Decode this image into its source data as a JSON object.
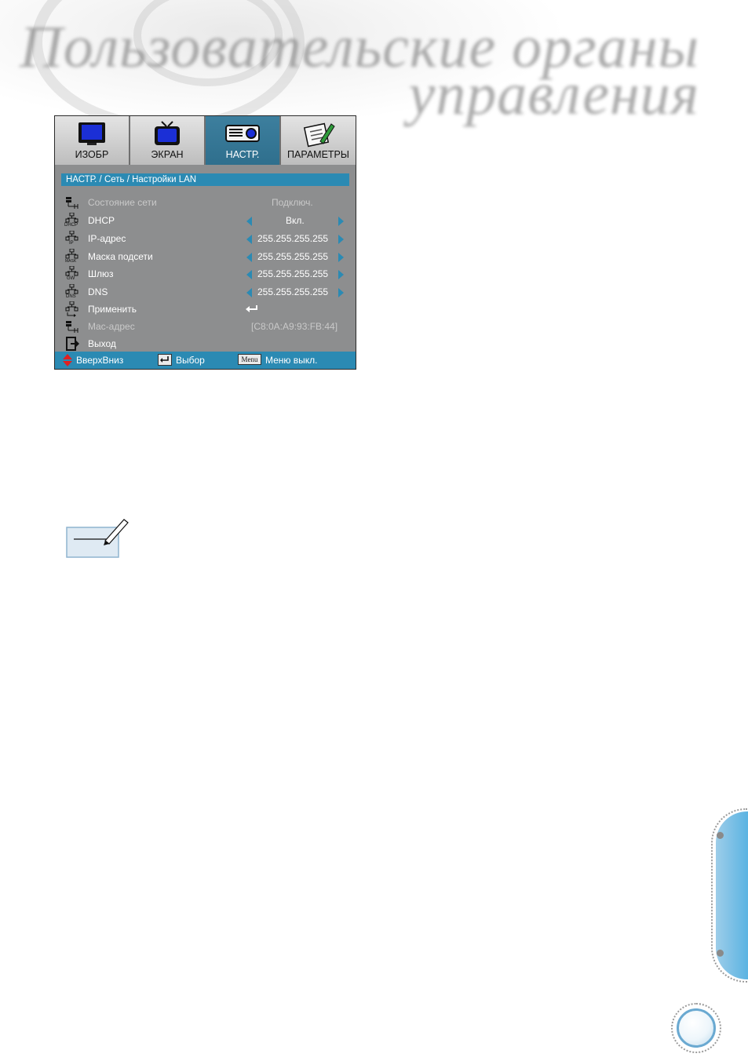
{
  "header": {
    "title_line1": "Пользовательские органы",
    "title_line2": "управления"
  },
  "osd": {
    "tabs": [
      {
        "label": "ИЗОБР",
        "icon": "monitor-icon",
        "active": false
      },
      {
        "label": "ЭКРАН",
        "icon": "tv-icon",
        "active": false
      },
      {
        "label": "НАСТР.",
        "icon": "projector-icon",
        "active": true
      },
      {
        "label": "ПАРАМЕТРЫ",
        "icon": "notepad-pen-icon",
        "active": false
      }
    ],
    "breadcrumb": "НАСТР. / Сеть / Настройки LAN",
    "rows": [
      {
        "label": "Состояние сети",
        "value": "Подключ.",
        "icon": "network-status-icon",
        "icon_text": ""
      },
      {
        "label": "DHCP",
        "value": "Вкл.",
        "icon": "network-dhcp-icon",
        "icon_text": "DHCP"
      },
      {
        "label": "IP-адрес",
        "value": "255.255.255.255",
        "icon": "network-ip-icon",
        "icon_text": "IP"
      },
      {
        "label": "Маска подсети",
        "value": "255.255.255.255",
        "icon": "network-mask-icon",
        "icon_text": "MASK"
      },
      {
        "label": "Шлюз",
        "value": "255.255.255.255",
        "icon": "network-gateway-icon",
        "icon_text": "GW"
      },
      {
        "label": "DNS",
        "value": "255.255.255.255",
        "icon": "network-dns-icon",
        "icon_text": "DNS"
      },
      {
        "label": "Применить",
        "value": "",
        "icon": "network-apply-icon",
        "icon_text": ""
      },
      {
        "label": "Mac-адрес",
        "value": "[C8:0A:A9:93:FB:44]",
        "icon": "network-mac-icon",
        "icon_text": ""
      },
      {
        "label": "Выход",
        "value": "",
        "icon": "exit-icon",
        "icon_text": ""
      }
    ],
    "footer": {
      "nav_label": "ВверхВниз",
      "select_label": "Выбор",
      "menu_key": "Menu",
      "menu_label": "Меню выкл."
    }
  },
  "colors": {
    "accent": "#2b8ab3",
    "panel": "#8d8e8f",
    "tab_active": "#3d7f9e"
  }
}
